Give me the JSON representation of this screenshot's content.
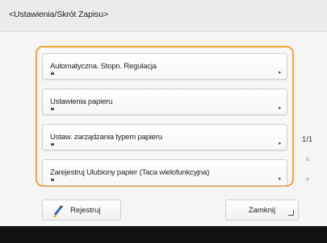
{
  "header": {
    "title": "<Ustawienia/Skrót Zapisu>"
  },
  "list": {
    "items": [
      {
        "label": "Automatyczna. Stopn. Regulacja"
      },
      {
        "label": "Ustawienia papieru"
      },
      {
        "label": "Ustaw. zarządzania typem papieru"
      },
      {
        "label": "Zarejestruj Ulubiony papier (Taca wielofunkcyjna)"
      }
    ]
  },
  "pager": {
    "indicator": "1/1",
    "up_icon": "triangle-up-icon",
    "down_icon": "triangle-down-icon"
  },
  "footer_buttons": {
    "register_label": "Rejestruj",
    "close_label": "Zamknij"
  },
  "colors": {
    "accent": "#f2a531",
    "footer": "#111111",
    "disabled": "#c9c9c9"
  }
}
